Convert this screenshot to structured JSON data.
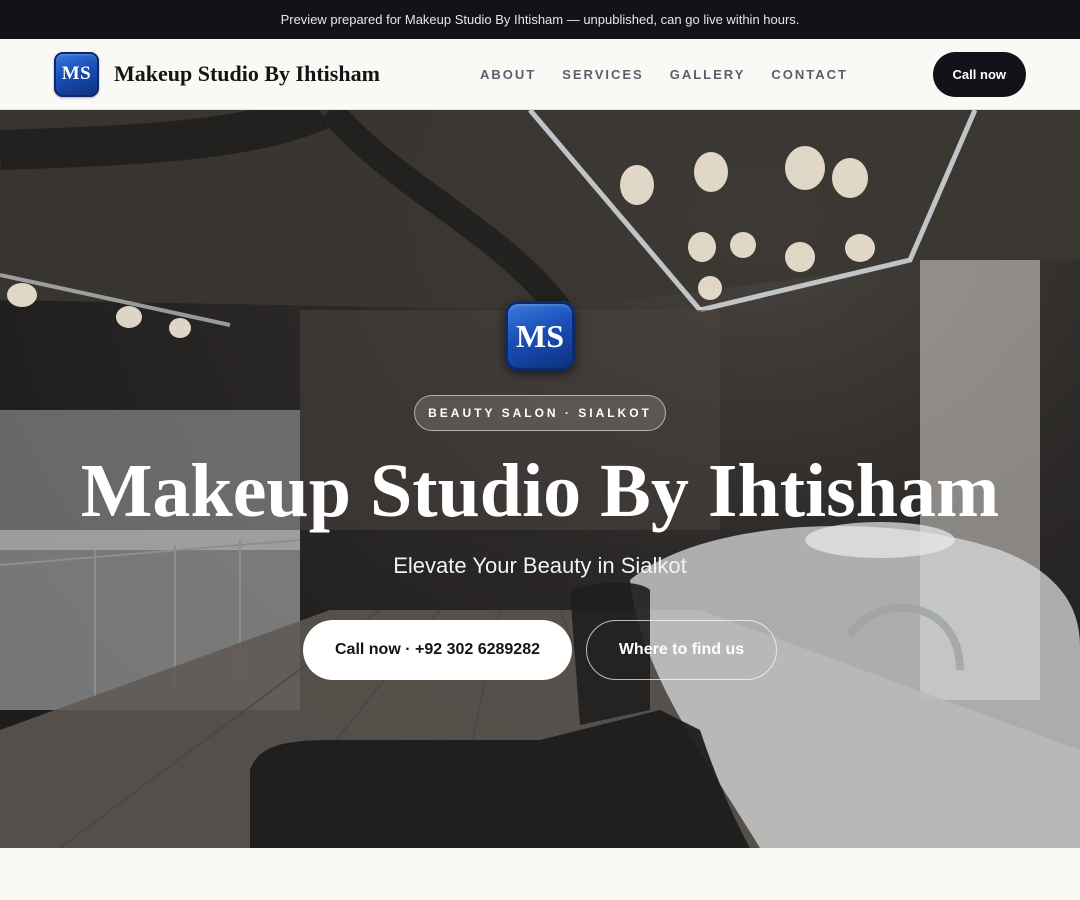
{
  "topbar": {
    "text": "Preview prepared for Makeup Studio By Ihtisham — unpublished, can go live within hours."
  },
  "header": {
    "logo_text": "MS",
    "brand_name": "Makeup Studio By Ihtisham",
    "nav": [
      {
        "label": "ABOUT"
      },
      {
        "label": "SERVICES"
      },
      {
        "label": "GALLERY"
      },
      {
        "label": "CONTACT"
      }
    ],
    "cta_label": "Call now"
  },
  "hero": {
    "logo_text": "MS",
    "badge": "BEAUTY SALON · SIALKOT",
    "title": "Makeup Studio By Ihtisham",
    "subtitle": "Elevate Your Beauty in Sialkot",
    "primary_cta": "Call now · +92 302 6289282",
    "secondary_cta": "Where to find us"
  },
  "colors": {
    "topbar_bg": "#111318",
    "page_bg": "#faf9f6",
    "logo_blue": "#1a4fb8",
    "cta_dark": "#111318"
  }
}
